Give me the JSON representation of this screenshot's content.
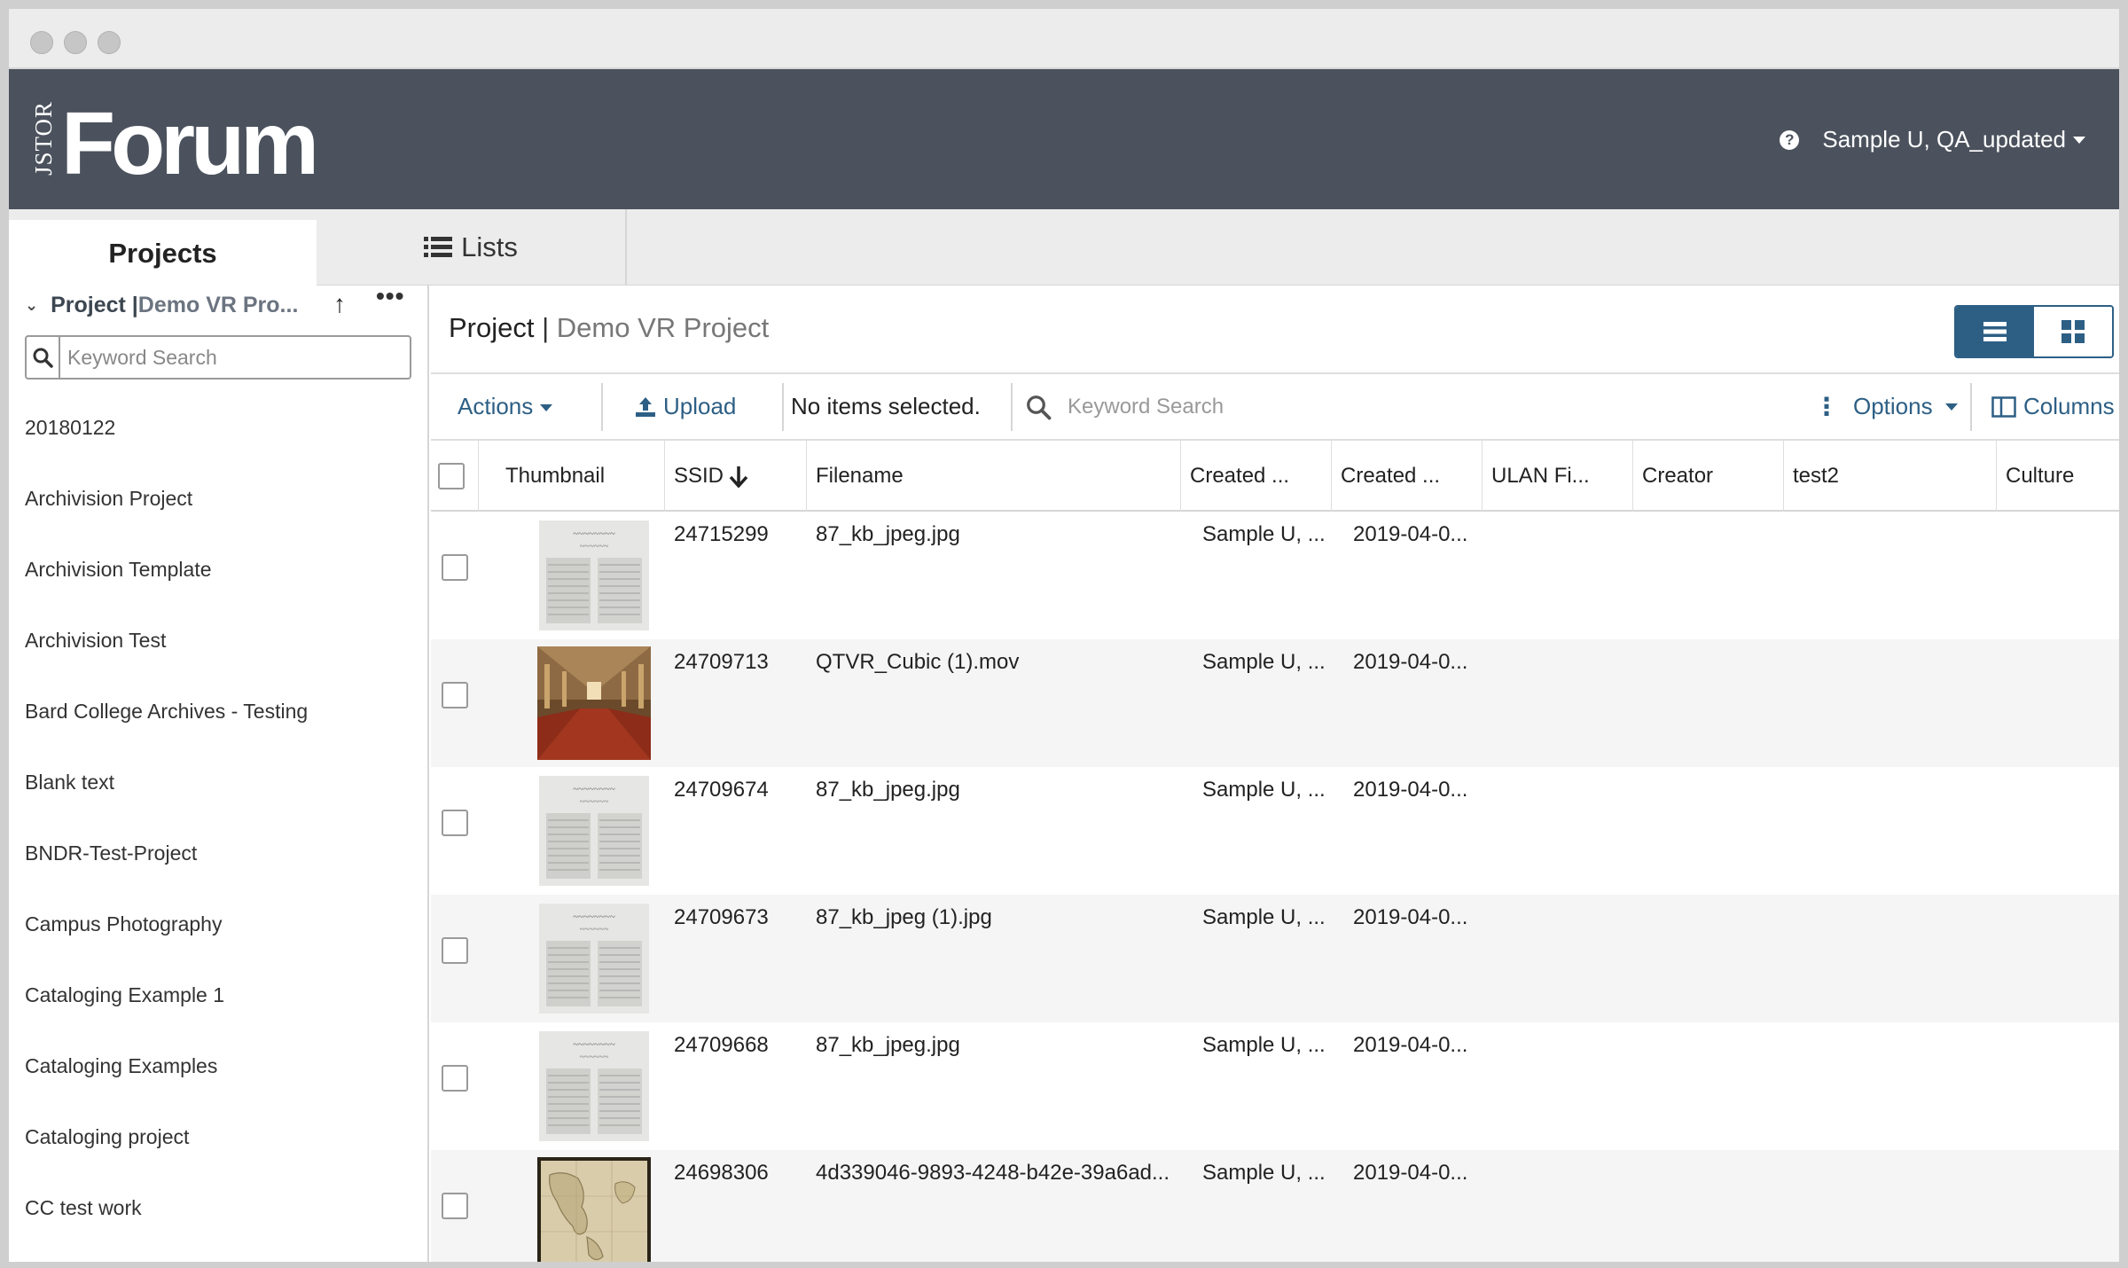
{
  "header": {
    "logo_small": "JSTOR",
    "logo_big": "Forum",
    "help_glyph": "?",
    "user_label": "Sample U, QA_updated"
  },
  "tabs": {
    "projects": "Projects",
    "lists": "Lists"
  },
  "sidebar": {
    "title_prefix": "Project | ",
    "title_name": "Demo VR Pro...",
    "search_placeholder": "Keyword Search",
    "items": [
      "20180122",
      "Archivision Project",
      "Archivision Template",
      "Archivision Test",
      "Bard College Archives - Testing",
      "Blank text",
      "BNDR-Test-Project",
      "Campus Photography",
      "Cataloging Example 1",
      "Cataloging Examples",
      "Cataloging project",
      "CC test work"
    ]
  },
  "main": {
    "title_prefix": "Project",
    "title_sep": "|",
    "title_name": "Demo VR Project"
  },
  "toolbar": {
    "actions": "Actions",
    "upload": "Upload",
    "selection_status": "No items selected.",
    "search_placeholder": "Keyword Search",
    "options": "Options",
    "columns": "Columns"
  },
  "grid": {
    "columns": [
      "Thumbnail",
      "SSID",
      "Filename",
      "Created ...",
      "Created ...",
      "ULAN Fi...",
      "Creator",
      "test2",
      "Culture"
    ],
    "rows": [
      {
        "ssid": "24715299",
        "filename": "87_kb_jpeg.jpg",
        "created_by": "Sample U, ...",
        "created_on": "2019-04-0...",
        "thumb": "newspaper-clipping"
      },
      {
        "ssid": "24709713",
        "filename": "QTVR_Cubic (1).mov",
        "created_by": "Sample U, ...",
        "created_on": "2019-04-0...",
        "thumb": "mosque-interior"
      },
      {
        "ssid": "24709674",
        "filename": "87_kb_jpeg.jpg",
        "created_by": "Sample U, ...",
        "created_on": "2019-04-0...",
        "thumb": "newspaper-clipping"
      },
      {
        "ssid": "24709673",
        "filename": "87_kb_jpeg (1).jpg",
        "created_by": "Sample U, ...",
        "created_on": "2019-04-0...",
        "thumb": "newspaper-clipping"
      },
      {
        "ssid": "24709668",
        "filename": "87_kb_jpeg.jpg",
        "created_by": "Sample U, ...",
        "created_on": "2019-04-0...",
        "thumb": "newspaper-clipping"
      },
      {
        "ssid": "24698306",
        "filename": "4d339046-9893-4248-b42e-39a6ad...",
        "created_by": "Sample U, ...",
        "created_on": "2019-04-0...",
        "thumb": "antique-map"
      }
    ]
  },
  "colors": {
    "header_bg": "#4b525d",
    "accent": "#2d5f85",
    "row_alt": "#f5f5f5"
  }
}
